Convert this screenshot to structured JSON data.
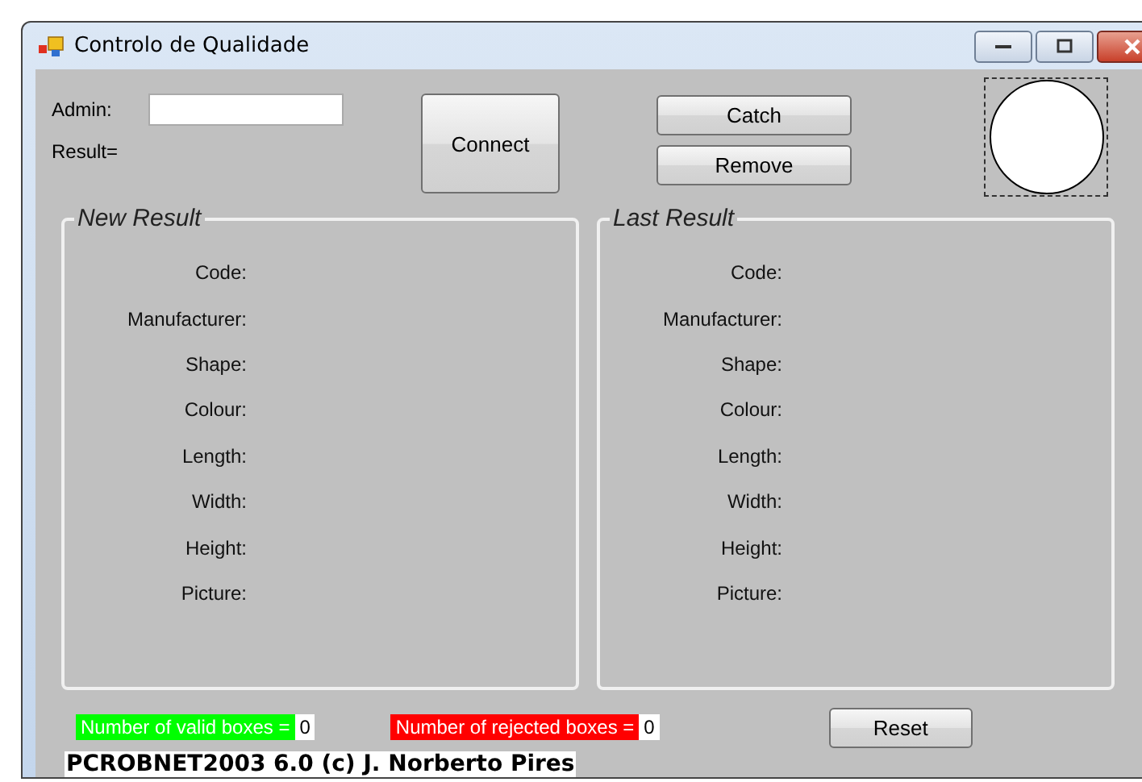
{
  "window": {
    "title": "Controlo de Qualidade"
  },
  "admin_label": "Admin:",
  "result_label": "Result=",
  "buttons": {
    "connect": "Connect",
    "catch": "Catch",
    "remove": "Remove",
    "reset": "Reset"
  },
  "groups": [
    {
      "title": "New Result",
      "fields": [
        "Code:",
        "Manufacturer:",
        "Shape:",
        "Colour:",
        "Length:",
        "Width:",
        "Height:",
        "Picture:"
      ]
    },
    {
      "title": "Last Result",
      "fields": [
        "Code:",
        "Manufacturer:",
        "Shape:",
        "Colour:",
        "Length:",
        "Width:",
        "Height:",
        "Picture:"
      ]
    }
  ],
  "counters": [
    {
      "label": "Number of valid boxes =",
      "value": "0",
      "color": "#00ff00"
    },
    {
      "label": "Number of rejected boxes =",
      "value": "0",
      "color": "#ff0000"
    }
  ],
  "footer": "PCROBNET2003 6.0 (c) J. Norberto Pires"
}
